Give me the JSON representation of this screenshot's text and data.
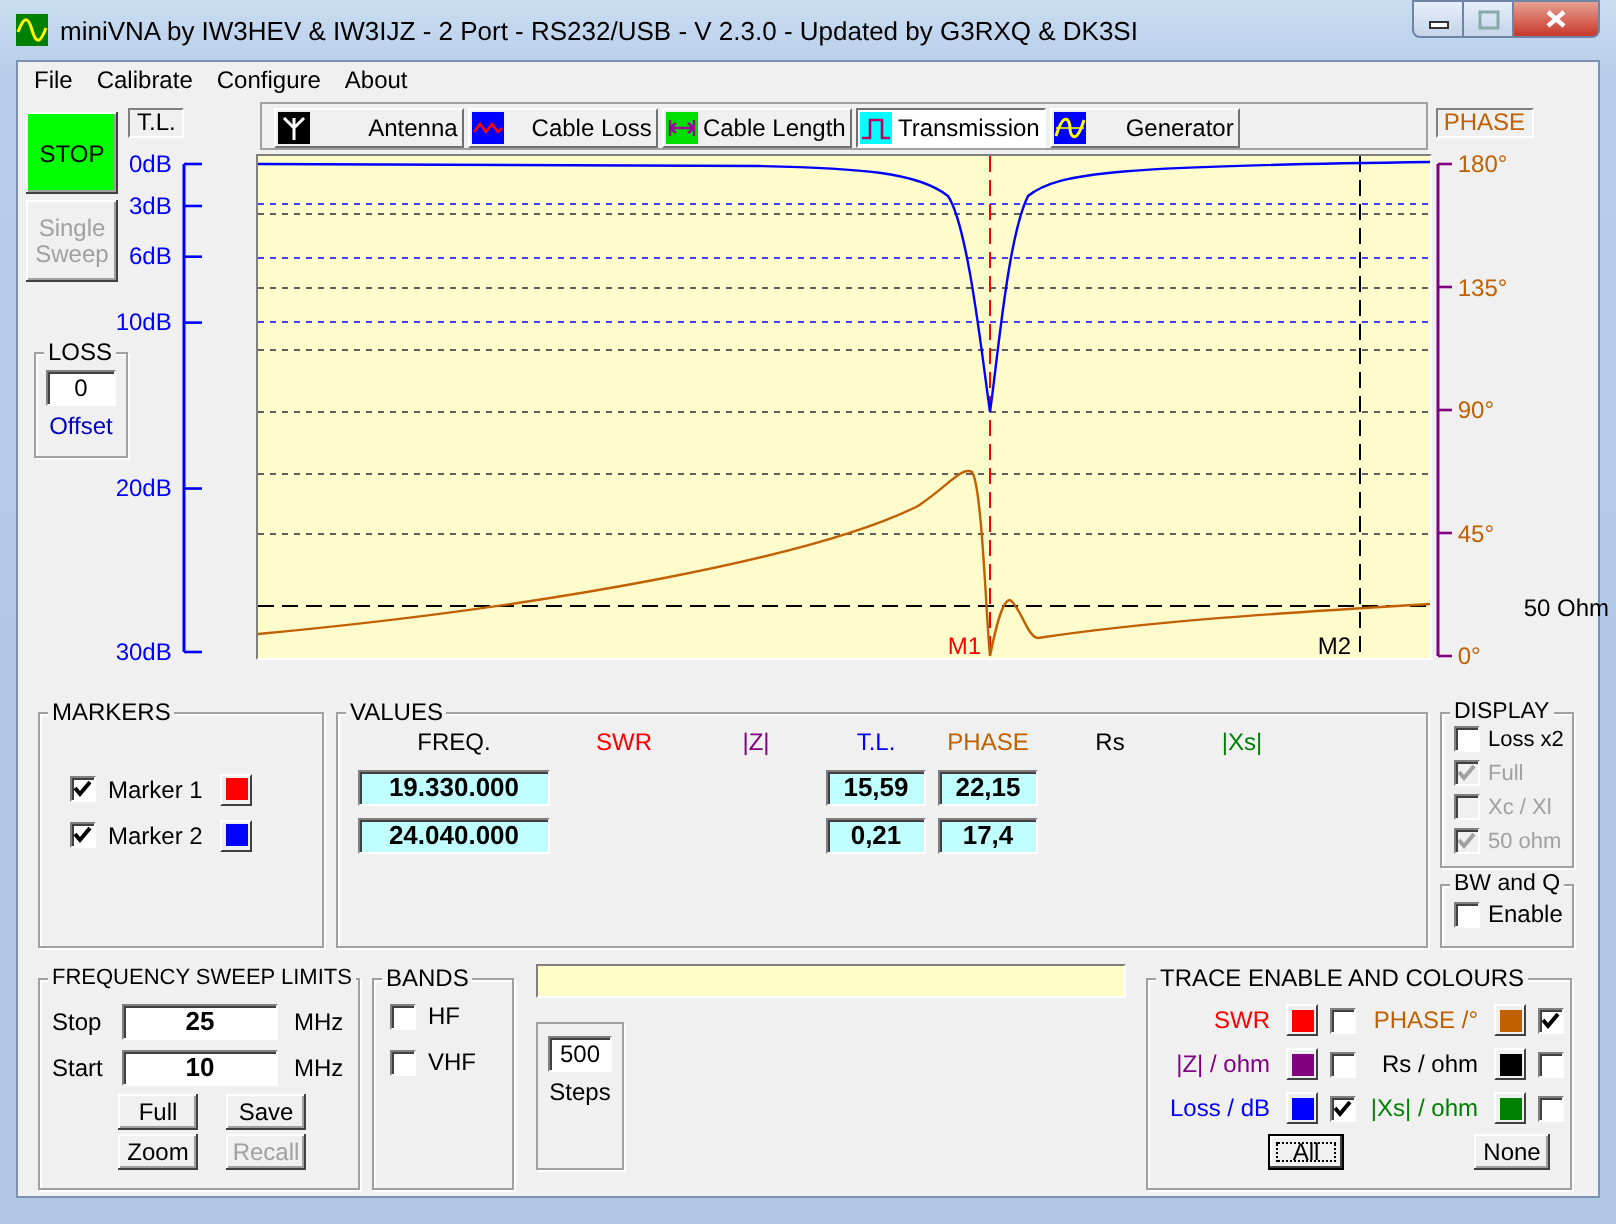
{
  "window": {
    "title": "miniVNA by IW3HEV & IW3IJZ - 2 Port - RS232/USB - V 2.3.0 - Updated by G3RXQ & DK3SI"
  },
  "menu": [
    "File",
    "Calibrate",
    "Configure",
    "About"
  ],
  "sweep_controls": {
    "stop": "STOP",
    "single_sweep": {
      "label": "Single Sweep",
      "disabled": true
    }
  },
  "loss": {
    "title": "LOSS",
    "value": "0",
    "caption": "Offset"
  },
  "tabs": [
    {
      "label": "Antenna",
      "selected": false
    },
    {
      "label": "Cable Loss",
      "selected": false
    },
    {
      "label": "Cable Length",
      "selected": false
    },
    {
      "label": "Transmission",
      "selected": true
    },
    {
      "label": "Generator",
      "selected": false
    }
  ],
  "plot": {
    "left_title": "T.L.",
    "left_ticks": [
      "0dB",
      "3dB",
      "6dB",
      "10dB",
      "20dB",
      "30dB"
    ],
    "right_title": "PHASE",
    "right_ticks": [
      "180°",
      "135°",
      "90°",
      "45°",
      "0°"
    ],
    "markers": [
      "M1",
      "M2"
    ],
    "reference_label": "50 Ohm"
  },
  "markers": {
    "title": "MARKERS",
    "items": [
      {
        "label": "Marker 1",
        "checked": true,
        "color": "#ff0000"
      },
      {
        "label": "Marker 2",
        "checked": true,
        "color": "#0000ff"
      }
    ]
  },
  "values": {
    "title": "VALUES",
    "columns": [
      {
        "kind": "freq",
        "label": "FREQ.",
        "color": "#000000"
      },
      {
        "kind": "swr",
        "label": "SWR",
        "color": "#ff0000"
      },
      {
        "kind": "z",
        "label": "|Z|",
        "color": "#800080"
      },
      {
        "kind": "tl",
        "label": "T.L.",
        "color": "#0000ff"
      },
      {
        "kind": "phase",
        "label": "PHASE",
        "color": "#c06000"
      },
      {
        "kind": "rs",
        "label": "Rs",
        "color": "#000000"
      },
      {
        "kind": "xs",
        "label": "|Xs|",
        "color": "#008000"
      }
    ],
    "rows": [
      {
        "freq": "19.330.000",
        "tl": "15,59",
        "phase": "22,15"
      },
      {
        "freq": "24.040.000",
        "tl": "0,21",
        "phase": "17,4"
      }
    ]
  },
  "display": {
    "title": "DISPLAY",
    "items": [
      {
        "label": "Loss x2",
        "checked": false,
        "disabled": false
      },
      {
        "label": "Full",
        "checked": true,
        "disabled": true
      },
      {
        "label": "Xc / Xl",
        "checked": false,
        "disabled": true
      },
      {
        "label": "50 ohm",
        "checked": true,
        "disabled": true
      }
    ]
  },
  "bw_q": {
    "title": "BW and Q",
    "label": "Enable",
    "checked": false
  },
  "frequency_sweep": {
    "title": "FREQUENCY SWEEP LIMITS",
    "fields": [
      {
        "label": "Stop",
        "value": "25",
        "unit": "MHz"
      },
      {
        "label": "Start",
        "value": "10",
        "unit": "MHz"
      }
    ],
    "buttons": [
      {
        "label": "Full",
        "disabled": false
      },
      {
        "label": "Save",
        "disabled": false
      },
      {
        "label": "Zoom",
        "disabled": false
      },
      {
        "label": "Recall",
        "disabled": true
      }
    ]
  },
  "bands": {
    "title": "BANDS",
    "items": [
      {
        "label": "HF",
        "checked": false
      },
      {
        "label": "VHF",
        "checked": false
      }
    ]
  },
  "steps": {
    "value": "500",
    "label": "Steps"
  },
  "traces": {
    "title": "TRACE ENABLE AND COLOURS",
    "items": [
      {
        "label": "SWR",
        "color": "#ff0000",
        "checked": false
      },
      {
        "label": "PHASE /°",
        "color": "#c06000",
        "checked": true
      },
      {
        "label": "|Z| / ohm",
        "color": "#800080",
        "checked": false
      },
      {
        "label": "Rs / ohm",
        "color": "#000000",
        "checked": false
      },
      {
        "label": "Loss / dB",
        "color": "#0000ff",
        "checked": true
      },
      {
        "label": "|Xs| / ohm",
        "color": "#008000",
        "checked": false
      }
    ],
    "buttons": [
      {
        "label": "All",
        "focused": true
      },
      {
        "label": "None",
        "focused": false
      }
    ]
  }
}
